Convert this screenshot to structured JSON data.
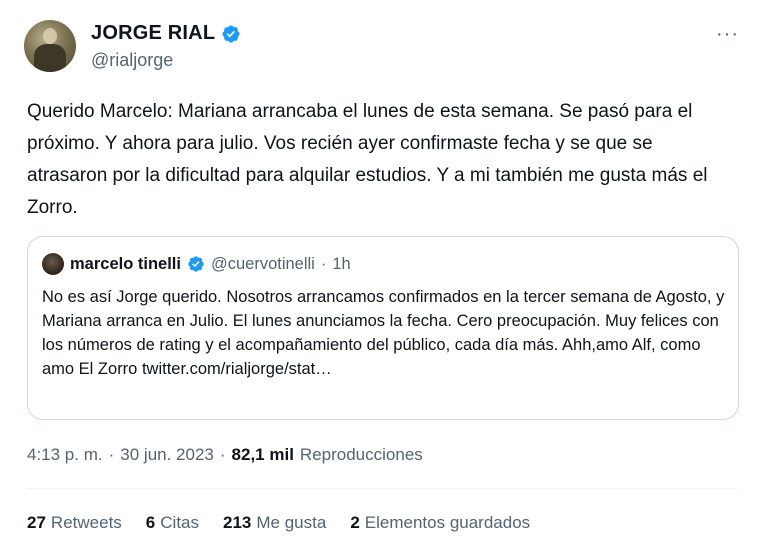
{
  "author": {
    "name": "JORGE RIAL",
    "handle": "@rialjorge",
    "verified_icon": "verified-badge-icon",
    "verified_color": "#1d9bf0"
  },
  "more_icon": "···",
  "tweet": {
    "text": "Querido Marcelo: Mariana arrancaba el lunes de esta semana. Se pasó para el próximo. Y ahora para julio. Vos recién ayer confirmaste fecha y se que se atrasaron por la dificultad para alquilar estudios. Y a mi también me gusta más el Zorro."
  },
  "quote": {
    "name": "marcelo tinelli",
    "handle": "@cuervotinelli",
    "dot": "·",
    "time": "1h",
    "text": "No es así Jorge querido. Nosotros arrancamos confirmados en la tercer semana de Agosto, y Mariana arranca en Julio. El lunes anunciamos la fecha. Cero preocupación. Muy felices con los números de rating y el acompañamiento del público, cada día más. Ahh,amo Alf, como amo El Zorro twitter.com/rialjorge/stat…"
  },
  "meta": {
    "time": "4:13 p. m.",
    "sep1": "·",
    "date": "30 jun. 2023",
    "sep2": "·",
    "views_count": "82,1 mil",
    "views_label": "Reproducciones"
  },
  "stats": [
    {
      "num": "27",
      "label": "Retweets"
    },
    {
      "num": "6",
      "label": "Citas"
    },
    {
      "num": "213",
      "label": "Me gusta"
    },
    {
      "num": "2",
      "label": "Elementos guardados"
    }
  ]
}
